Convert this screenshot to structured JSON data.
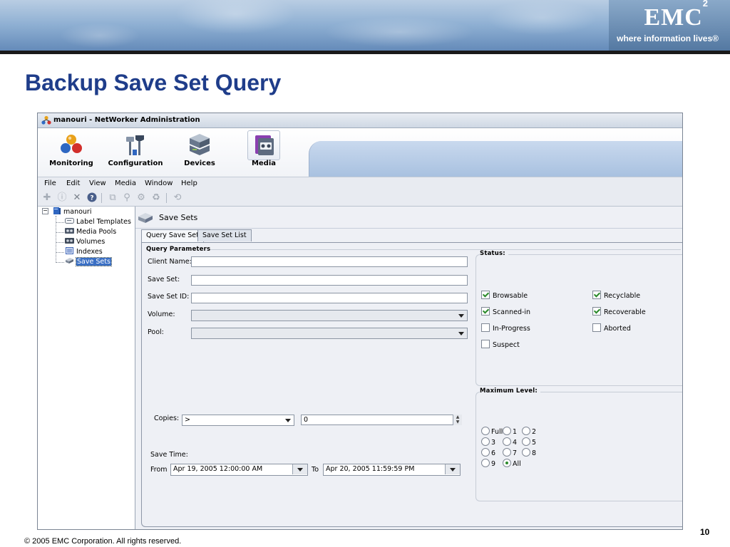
{
  "slide": {
    "title": "Backup Save Set Query",
    "logo": "EMC",
    "logo_sup": "2",
    "tagline": "where information lives®",
    "copyright": "© 2005 EMC Corporation. All rights reserved.",
    "page_number": "10"
  },
  "window": {
    "title": "manouri - NetWorker Administration"
  },
  "launcher": [
    {
      "label": "Monitoring",
      "icon": "monitoring-icon"
    },
    {
      "label": "Configuration",
      "icon": "configuration-icon"
    },
    {
      "label": "Devices",
      "icon": "devices-icon"
    },
    {
      "label": "Media",
      "icon": "media-icon"
    }
  ],
  "menu": [
    "File",
    "Edit",
    "View",
    "Media",
    "Window",
    "Help"
  ],
  "tree": {
    "root": "manouri",
    "items": [
      "Label Templates",
      "Media Pools",
      "Volumes",
      "Indexes",
      "Save Sets"
    ],
    "selected": "Save Sets"
  },
  "content": {
    "header": "Save Sets",
    "tabs": [
      "Query Save Set",
      "Save Set List"
    ],
    "query": {
      "section": "Query Parameters",
      "client_label": "Client Name:",
      "client_value": "",
      "saveset_label": "Save Set:",
      "saveset_value": "",
      "savesetid_label": "Save Set ID:",
      "savesetid_value": "",
      "volume_label": "Volume:",
      "volume_value": "",
      "pool_label": "Pool:",
      "pool_value": "",
      "copies_label": "Copies:",
      "copies_operator": ">",
      "copies_value": "0",
      "savetime_label": "Save Time:",
      "from_label": "From",
      "from_value": "Apr 19, 2005 12:00:00 AM",
      "to_label": "To",
      "to_value": "Apr 20, 2005 11:59:59 PM"
    },
    "status": {
      "title": "Status:",
      "browsable": {
        "label": "Browsable",
        "checked": true
      },
      "recyclable": {
        "label": "Recyclable",
        "checked": true
      },
      "scanned_in": {
        "label": "Scanned-in",
        "checked": true
      },
      "recoverable": {
        "label": "Recoverable",
        "checked": true
      },
      "in_progress": {
        "label": "In-Progress",
        "checked": false
      },
      "aborted": {
        "label": "Aborted",
        "checked": false
      },
      "suspect": {
        "label": "Suspect",
        "checked": false
      }
    },
    "max_level": {
      "title": "Maximum Level:",
      "options": [
        "Full",
        "1",
        "2",
        "3",
        "4",
        "5",
        "6",
        "7",
        "8",
        "9",
        "All"
      ],
      "selected": "All"
    }
  }
}
